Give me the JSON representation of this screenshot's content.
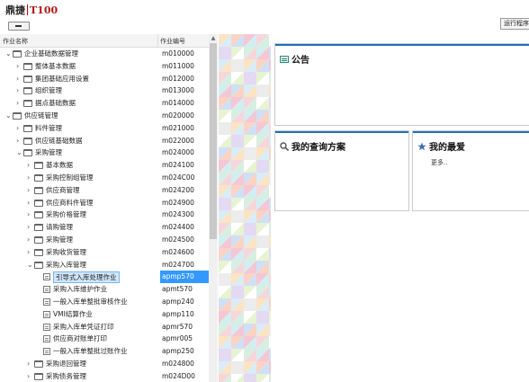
{
  "header": {
    "logo_cn": "鼎捷",
    "logo_en": "T100",
    "run_program_label": "运行程序"
  },
  "tree": {
    "columns": {
      "name": "作业名称",
      "code": "作业编号"
    },
    "rows": [
      {
        "level": 0,
        "expanded": true,
        "type": "folder",
        "label": "企业基础数据管理",
        "code": "m010000"
      },
      {
        "level": 1,
        "expanded": false,
        "type": "folder",
        "label": "整体基本数据",
        "code": "m011000"
      },
      {
        "level": 1,
        "expanded": false,
        "type": "folder",
        "label": "集团基础应用设置",
        "code": "m012000"
      },
      {
        "level": 1,
        "expanded": false,
        "type": "folder",
        "label": "组织管理",
        "code": "m013000"
      },
      {
        "level": 1,
        "expanded": false,
        "type": "folder",
        "label": "据点基础数据",
        "code": "m014000"
      },
      {
        "level": 0,
        "expanded": true,
        "type": "folder",
        "label": "供应链管理",
        "code": "m020000"
      },
      {
        "level": 1,
        "expanded": false,
        "type": "folder",
        "label": "料件管理",
        "code": "m021000"
      },
      {
        "level": 1,
        "expanded": false,
        "type": "folder",
        "label": "供应链基础数据",
        "code": "m022000"
      },
      {
        "level": 1,
        "expanded": true,
        "type": "folder",
        "label": "采购管理",
        "code": "m024000"
      },
      {
        "level": 2,
        "expanded": false,
        "type": "folder",
        "label": "基本数据",
        "code": "m024100"
      },
      {
        "level": 2,
        "expanded": false,
        "type": "folder",
        "label": "采购控制组管理",
        "code": "m024C00"
      },
      {
        "level": 2,
        "expanded": false,
        "type": "folder",
        "label": "供应商管理",
        "code": "m024200"
      },
      {
        "level": 2,
        "expanded": false,
        "type": "folder",
        "label": "供应商料件管理",
        "code": "m024900"
      },
      {
        "level": 2,
        "expanded": false,
        "type": "folder",
        "label": "采购价格管理",
        "code": "m024300"
      },
      {
        "level": 2,
        "expanded": false,
        "type": "folder",
        "label": "请购管理",
        "code": "m024400"
      },
      {
        "level": 2,
        "expanded": false,
        "type": "folder",
        "label": "采购管理",
        "code": "m024500"
      },
      {
        "level": 2,
        "expanded": false,
        "type": "folder",
        "label": "采购收货管理",
        "code": "m024600"
      },
      {
        "level": 2,
        "expanded": true,
        "type": "folder",
        "label": "采购入库管理",
        "code": "m024700"
      },
      {
        "level": 3,
        "type": "doc",
        "label": "引导式入库处理作业",
        "code": "apmp570",
        "selected": true
      },
      {
        "level": 3,
        "type": "doc",
        "label": "采购入库维护作业",
        "code": "apmt570"
      },
      {
        "level": 3,
        "type": "doc",
        "label": "一般入库单整批审核作业",
        "code": "apmp240"
      },
      {
        "level": 3,
        "type": "doc",
        "label": "VMI结算作业",
        "code": "apmp110"
      },
      {
        "level": 3,
        "type": "doc",
        "label": "采购入库单凭证打印",
        "code": "apmr570"
      },
      {
        "level": 3,
        "type": "doc",
        "label": "供应商对账单打印",
        "code": "apmr005"
      },
      {
        "level": 3,
        "type": "doc",
        "label": "一般入库单整批过账作业",
        "code": "apmp250"
      },
      {
        "level": 2,
        "expanded": false,
        "type": "folder",
        "label": "采购退回管理",
        "code": "m024800"
      },
      {
        "level": 2,
        "expanded": false,
        "type": "folder",
        "label": "采购债务管理",
        "code": "m024D00"
      }
    ]
  },
  "panels": {
    "announcement": {
      "title": "公告"
    },
    "my_query": {
      "title": "我的查询方案"
    },
    "my_favorites": {
      "title": "我的最爱",
      "more_label": "更多.."
    }
  }
}
